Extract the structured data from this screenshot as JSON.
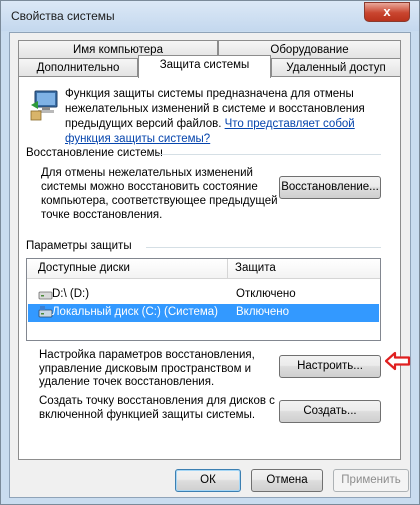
{
  "window": {
    "title": "Свойства системы",
    "close_symbol": "x"
  },
  "tabs": {
    "row_top": [
      "Имя компьютера",
      "Оборудование"
    ],
    "row_bottom": [
      "Дополнительно",
      "Защита системы",
      "Удаленный доступ"
    ],
    "active": "Защита системы"
  },
  "intro": {
    "line1": "Функция защиты системы предназначена для отмены",
    "line2": "нежелательных изменений в системе и восстановления",
    "line3_text": "предыдущих версий файлов.",
    "line3_link": "Что представляет собой",
    "line4_link": "функция защиты системы?",
    "icon": "system-protection-icon"
  },
  "restore": {
    "group_label": "Восстановление системы",
    "line1": "Для отмены нежелательных изменений",
    "line2": "системы можно восстановить состояние",
    "line3": "компьютера, соответствующее предыдущей",
    "line4": "точке восстановления.",
    "button": "Восстановление..."
  },
  "protection": {
    "group_label": "Параметры защиты",
    "columns": [
      "Доступные диски",
      "Защита"
    ],
    "drives": [
      {
        "name": "D:\\ (D:)",
        "status": "Отключено",
        "icon": "drive-icon",
        "selected": false
      },
      {
        "name": "Локальный диск (C:) (Система)",
        "status": "Включено",
        "icon": "system-drive-icon",
        "selected": true
      }
    ]
  },
  "configure": {
    "line1": "Настройка параметров восстановления,",
    "line2": "управление дисковым пространством и",
    "line3": "удаление точек восстановления.",
    "button": "Настроить..."
  },
  "create": {
    "line1": "Создать точку восстановления для дисков с",
    "line2": "включенной функцией защиты системы.",
    "button": "Создать..."
  },
  "footer": {
    "ok": "ОК",
    "cancel": "Отмена",
    "apply": "Применить"
  },
  "colors": {
    "selection": "#3399ff",
    "link": "#0645ad",
    "arrow": "#e02020"
  }
}
